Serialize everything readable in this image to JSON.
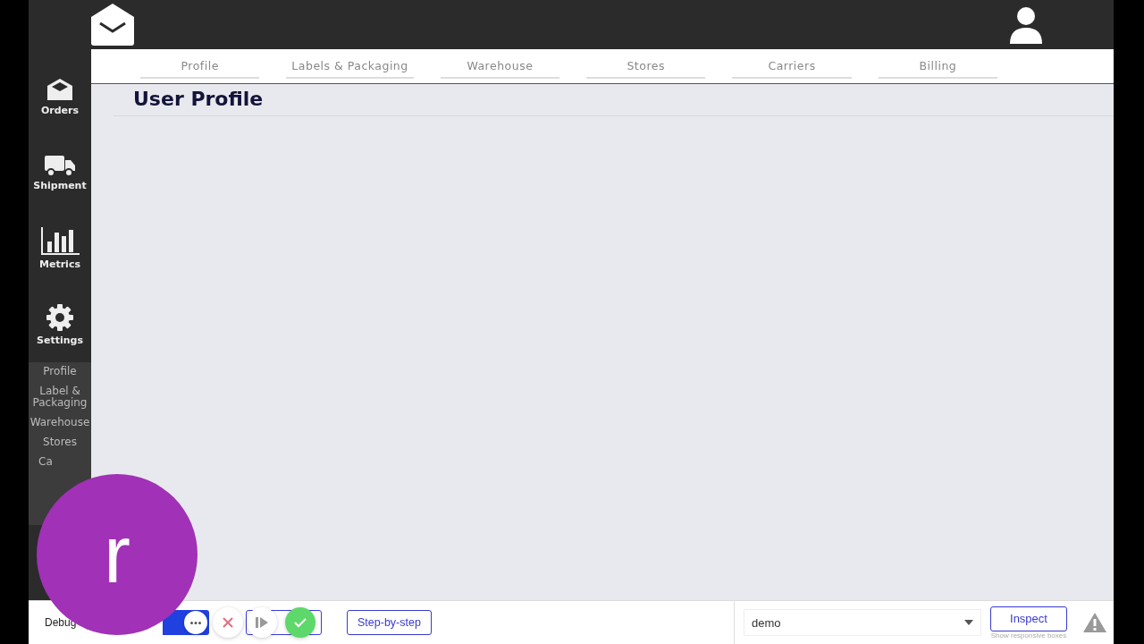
{
  "header": {
    "tabs": [
      {
        "label": "Profile"
      },
      {
        "label": "Labels & Packaging"
      },
      {
        "label": "Warehouse"
      },
      {
        "label": "Stores"
      },
      {
        "label": "Carriers"
      },
      {
        "label": "Billing"
      }
    ]
  },
  "sidebar": {
    "items": [
      {
        "label": "Orders"
      },
      {
        "label": "Shipment"
      },
      {
        "label": "Metrics"
      },
      {
        "label": "Settings"
      }
    ],
    "submenu": [
      {
        "label": "Profile"
      },
      {
        "label": "Label & Packaging"
      },
      {
        "label": "Warehouse"
      },
      {
        "label": "Stores"
      },
      {
        "label": "Ca"
      }
    ]
  },
  "page": {
    "title": "User Profile"
  },
  "overlay": {
    "avatar_letter": "r"
  },
  "debug_bar": {
    "label": "Debug",
    "step_button": "Step-by-step",
    "select_value": "demo",
    "inspect_button": "Inspect",
    "inspect_hint": "Show responsive boxes"
  }
}
